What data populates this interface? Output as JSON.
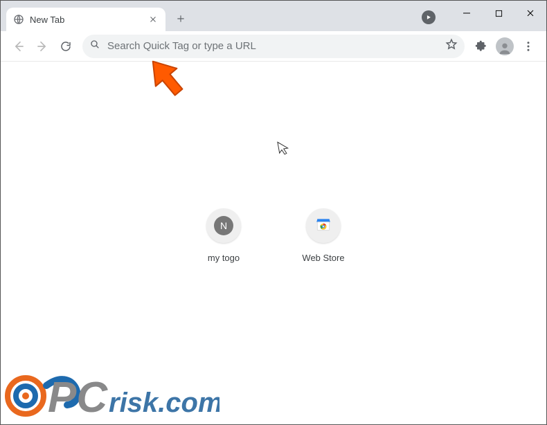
{
  "tab": {
    "title": "New Tab"
  },
  "omnibox": {
    "placeholder": "Search Quick Tag or type a URL"
  },
  "shortcuts": {
    "0": {
      "label": "my togo",
      "letter": "N"
    },
    "1": {
      "label": "Web Store"
    }
  },
  "watermark": {
    "text": "risk.com"
  }
}
